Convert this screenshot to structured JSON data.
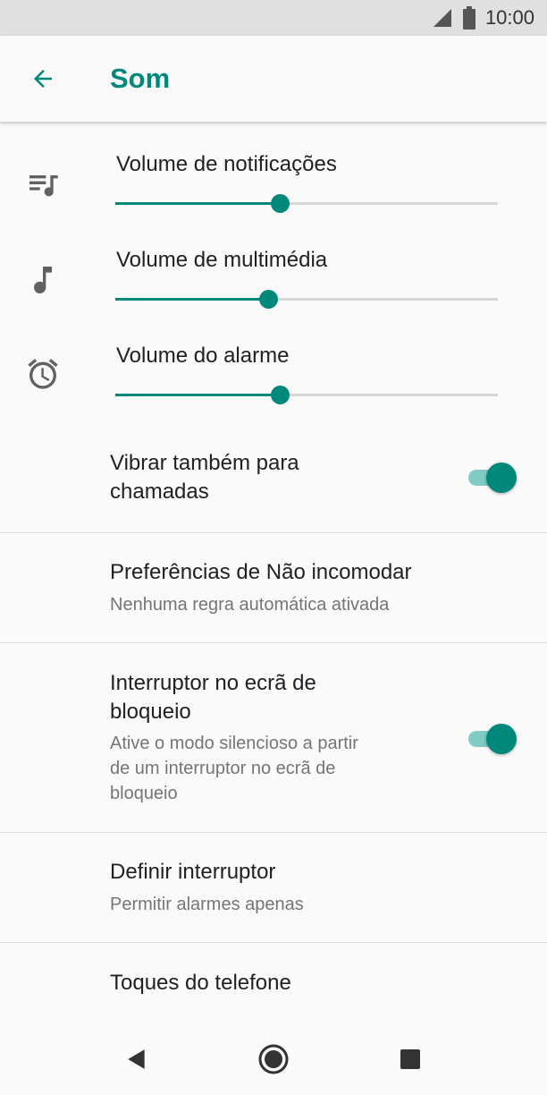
{
  "status_bar": {
    "time": "10:00",
    "signal_icon": "signal-icon",
    "battery_icon": "battery-icon"
  },
  "app_bar": {
    "title": "Som",
    "back_icon": "arrow-back-icon"
  },
  "accent_color": "#00897b",
  "volumes": [
    {
      "label": "Volume de notificações",
      "icon": "notification-queue-music-icon",
      "level": 0.43
    },
    {
      "label": "Volume de multimédia",
      "icon": "music-note-icon",
      "level": 0.4
    },
    {
      "label": "Volume do alarme",
      "icon": "alarm-clock-icon",
      "level": 0.43
    }
  ],
  "preferences": [
    {
      "title": "Vibrar também para chamadas",
      "title_lines": [
        "Vibrar também para",
        "chamadas"
      ],
      "switch_on": true
    },
    {
      "title": "Preferências de Não incomodar",
      "summary": "Nenhuma regra automática ativada"
    },
    {
      "title_lines": [
        "Interruptor no ecrã de",
        "bloqueio"
      ],
      "summary_lines": [
        "Ative o modo silencioso a partir",
        "de um interruptor no ecrã de",
        "bloqueio"
      ],
      "switch_on": true
    },
    {
      "title": "Definir interruptor",
      "summary": "Permitir alarmes apenas"
    },
    {
      "title": "Toques do telefone"
    }
  ],
  "nav_bar": {
    "back": "nav-back-icon",
    "home": "nav-home-icon",
    "recents": "nav-recents-icon"
  }
}
